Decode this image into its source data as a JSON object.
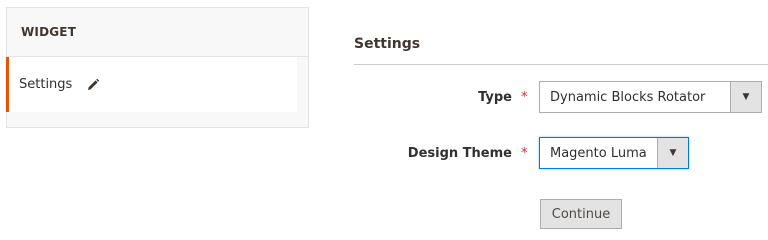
{
  "left": {
    "header": "WIDGET",
    "item_label": "Settings"
  },
  "main": {
    "section_title": "Settings",
    "type_label": "Type",
    "type_value": "Dynamic Blocks Rotator",
    "theme_label": "Design Theme",
    "theme_value": "Magento Luma",
    "required_mark": "*",
    "continue_label": "Continue"
  },
  "colors": {
    "active_accent": "#eb5202",
    "required": "#e22626",
    "focus": "#007bdb"
  }
}
